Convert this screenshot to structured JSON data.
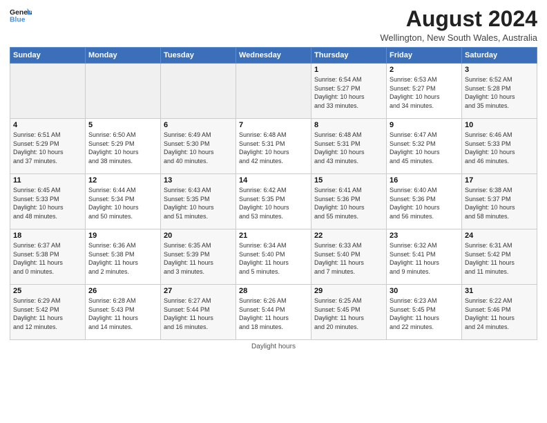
{
  "header": {
    "logo_line1": "General",
    "logo_line2": "Blue",
    "month_year": "August 2024",
    "location": "Wellington, New South Wales, Australia"
  },
  "days_of_week": [
    "Sunday",
    "Monday",
    "Tuesday",
    "Wednesday",
    "Thursday",
    "Friday",
    "Saturday"
  ],
  "footer": "Daylight hours",
  "weeks": [
    [
      {
        "day": "",
        "text": ""
      },
      {
        "day": "",
        "text": ""
      },
      {
        "day": "",
        "text": ""
      },
      {
        "day": "",
        "text": ""
      },
      {
        "day": "1",
        "text": "Sunrise: 6:54 AM\nSunset: 5:27 PM\nDaylight: 10 hours\nand 33 minutes."
      },
      {
        "day": "2",
        "text": "Sunrise: 6:53 AM\nSunset: 5:27 PM\nDaylight: 10 hours\nand 34 minutes."
      },
      {
        "day": "3",
        "text": "Sunrise: 6:52 AM\nSunset: 5:28 PM\nDaylight: 10 hours\nand 35 minutes."
      }
    ],
    [
      {
        "day": "4",
        "text": "Sunrise: 6:51 AM\nSunset: 5:29 PM\nDaylight: 10 hours\nand 37 minutes."
      },
      {
        "day": "5",
        "text": "Sunrise: 6:50 AM\nSunset: 5:29 PM\nDaylight: 10 hours\nand 38 minutes."
      },
      {
        "day": "6",
        "text": "Sunrise: 6:49 AM\nSunset: 5:30 PM\nDaylight: 10 hours\nand 40 minutes."
      },
      {
        "day": "7",
        "text": "Sunrise: 6:48 AM\nSunset: 5:31 PM\nDaylight: 10 hours\nand 42 minutes."
      },
      {
        "day": "8",
        "text": "Sunrise: 6:48 AM\nSunset: 5:31 PM\nDaylight: 10 hours\nand 43 minutes."
      },
      {
        "day": "9",
        "text": "Sunrise: 6:47 AM\nSunset: 5:32 PM\nDaylight: 10 hours\nand 45 minutes."
      },
      {
        "day": "10",
        "text": "Sunrise: 6:46 AM\nSunset: 5:33 PM\nDaylight: 10 hours\nand 46 minutes."
      }
    ],
    [
      {
        "day": "11",
        "text": "Sunrise: 6:45 AM\nSunset: 5:33 PM\nDaylight: 10 hours\nand 48 minutes."
      },
      {
        "day": "12",
        "text": "Sunrise: 6:44 AM\nSunset: 5:34 PM\nDaylight: 10 hours\nand 50 minutes."
      },
      {
        "day": "13",
        "text": "Sunrise: 6:43 AM\nSunset: 5:35 PM\nDaylight: 10 hours\nand 51 minutes."
      },
      {
        "day": "14",
        "text": "Sunrise: 6:42 AM\nSunset: 5:35 PM\nDaylight: 10 hours\nand 53 minutes."
      },
      {
        "day": "15",
        "text": "Sunrise: 6:41 AM\nSunset: 5:36 PM\nDaylight: 10 hours\nand 55 minutes."
      },
      {
        "day": "16",
        "text": "Sunrise: 6:40 AM\nSunset: 5:36 PM\nDaylight: 10 hours\nand 56 minutes."
      },
      {
        "day": "17",
        "text": "Sunrise: 6:38 AM\nSunset: 5:37 PM\nDaylight: 10 hours\nand 58 minutes."
      }
    ],
    [
      {
        "day": "18",
        "text": "Sunrise: 6:37 AM\nSunset: 5:38 PM\nDaylight: 11 hours\nand 0 minutes."
      },
      {
        "day": "19",
        "text": "Sunrise: 6:36 AM\nSunset: 5:38 PM\nDaylight: 11 hours\nand 2 minutes."
      },
      {
        "day": "20",
        "text": "Sunrise: 6:35 AM\nSunset: 5:39 PM\nDaylight: 11 hours\nand 3 minutes."
      },
      {
        "day": "21",
        "text": "Sunrise: 6:34 AM\nSunset: 5:40 PM\nDaylight: 11 hours\nand 5 minutes."
      },
      {
        "day": "22",
        "text": "Sunrise: 6:33 AM\nSunset: 5:40 PM\nDaylight: 11 hours\nand 7 minutes."
      },
      {
        "day": "23",
        "text": "Sunrise: 6:32 AM\nSunset: 5:41 PM\nDaylight: 11 hours\nand 9 minutes."
      },
      {
        "day": "24",
        "text": "Sunrise: 6:31 AM\nSunset: 5:42 PM\nDaylight: 11 hours\nand 11 minutes."
      }
    ],
    [
      {
        "day": "25",
        "text": "Sunrise: 6:29 AM\nSunset: 5:42 PM\nDaylight: 11 hours\nand 12 minutes."
      },
      {
        "day": "26",
        "text": "Sunrise: 6:28 AM\nSunset: 5:43 PM\nDaylight: 11 hours\nand 14 minutes."
      },
      {
        "day": "27",
        "text": "Sunrise: 6:27 AM\nSunset: 5:44 PM\nDaylight: 11 hours\nand 16 minutes."
      },
      {
        "day": "28",
        "text": "Sunrise: 6:26 AM\nSunset: 5:44 PM\nDaylight: 11 hours\nand 18 minutes."
      },
      {
        "day": "29",
        "text": "Sunrise: 6:25 AM\nSunset: 5:45 PM\nDaylight: 11 hours\nand 20 minutes."
      },
      {
        "day": "30",
        "text": "Sunrise: 6:23 AM\nSunset: 5:45 PM\nDaylight: 11 hours\nand 22 minutes."
      },
      {
        "day": "31",
        "text": "Sunrise: 6:22 AM\nSunset: 5:46 PM\nDaylight: 11 hours\nand 24 minutes."
      }
    ]
  ]
}
